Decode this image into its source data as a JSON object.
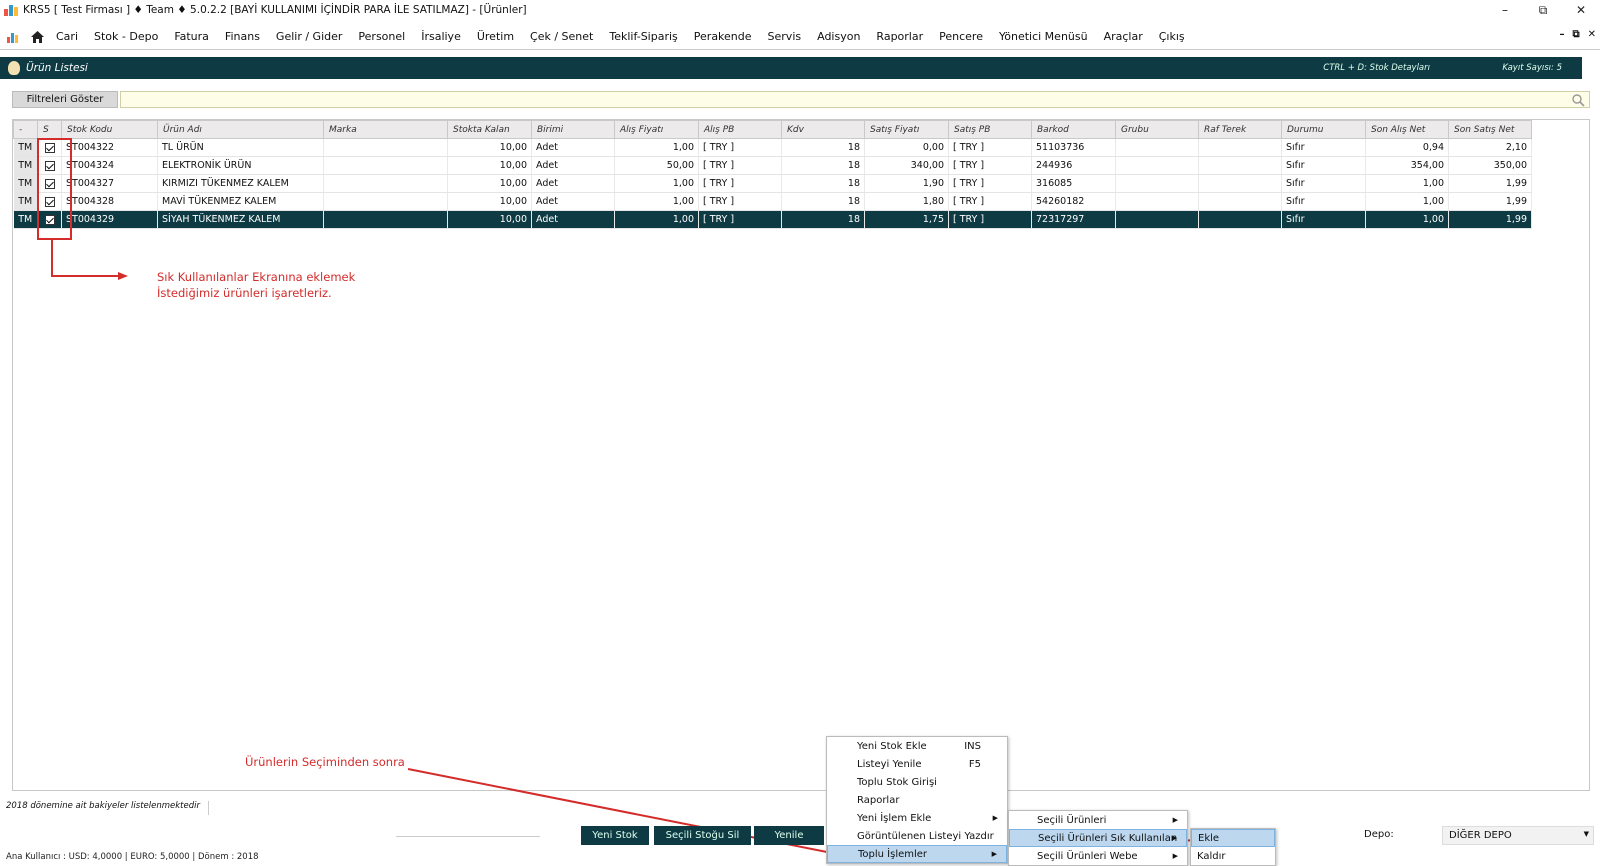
{
  "window": {
    "title": "KRS5 [ Test Firması ] ♦ Team ♦ 5.0.2.2 [BAYİ KULLANIMI İÇİNDİR PARA İLE SATILMAZ] - [Ürünler]"
  },
  "menu": [
    "Cari",
    "Stok - Depo",
    "Fatura",
    "Finans",
    "Gelir / Gider",
    "Personel",
    "İrsaliye",
    "Üretim",
    "Çek / Senet",
    "Teklif-Sipariş",
    "Perakende",
    "Servis",
    "Adisyon",
    "Raporlar",
    "Pencere",
    "Yönetici Menüsü",
    "Araçlar",
    "Çıkış"
  ],
  "panel": {
    "title": "Ürün Listesi",
    "hint": "CTRL + D: Stok Detayları",
    "count": "Kayıt Sayısı: 5"
  },
  "filter": {
    "button": "Filtreleri Göster",
    "value": ""
  },
  "grid": {
    "columns": [
      "-",
      "S",
      "Stok Kodu",
      "Ürün Adı",
      "Marka",
      "Stokta Kalan",
      "Birimi",
      "Alış Fiyatı",
      "Alış PB",
      "Kdv",
      "Satış Fiyatı",
      "Satış PB",
      "Barkod",
      "Grubu",
      "Raf Terek",
      "Durumu",
      "Son Alış Net",
      "Son Satış Net"
    ],
    "rows": [
      {
        "tm": "TM",
        "checked": true,
        "code": "ST004322",
        "name": "TL ÜRÜN",
        "marka": "",
        "stok": "10,00",
        "birim": "Adet",
        "alis": "1,00",
        "alis_pb": "[ TRY ]",
        "kdv": "18",
        "satis": "0,00",
        "satis_pb": "[ TRY ]",
        "barkod": "51103736",
        "grup": "",
        "raf": "",
        "durum": "Sıfır",
        "son_alis": "0,94",
        "son_satis": "2,10"
      },
      {
        "tm": "TM",
        "checked": true,
        "code": "ST004324",
        "name": "ELEKTRONİK ÜRÜN",
        "marka": "",
        "stok": "10,00",
        "birim": "Adet",
        "alis": "50,00",
        "alis_pb": "[ TRY ]",
        "kdv": "18",
        "satis": "340,00",
        "satis_pb": "[ TRY ]",
        "barkod": "244936",
        "grup": "",
        "raf": "",
        "durum": "Sıfır",
        "son_alis": "354,00",
        "son_satis": "350,00"
      },
      {
        "tm": "TM",
        "checked": true,
        "code": "ST004327",
        "name": "KIRMIZI TÜKENMEZ KALEM",
        "marka": "",
        "stok": "10,00",
        "birim": "Adet",
        "alis": "1,00",
        "alis_pb": "[ TRY ]",
        "kdv": "18",
        "satis": "1,90",
        "satis_pb": "[ TRY ]",
        "barkod": "316085",
        "grup": "",
        "raf": "",
        "durum": "Sıfır",
        "son_alis": "1,00",
        "son_satis": "1,99"
      },
      {
        "tm": "TM",
        "checked": true,
        "code": "ST004328",
        "name": "MAVİ TÜKENMEZ KALEM",
        "marka": "",
        "stok": "10,00",
        "birim": "Adet",
        "alis": "1,00",
        "alis_pb": "[ TRY ]",
        "kdv": "18",
        "satis": "1,80",
        "satis_pb": "[ TRY ]",
        "barkod": "54260182",
        "grup": "",
        "raf": "",
        "durum": "Sıfır",
        "son_alis": "1,00",
        "son_satis": "1,99"
      },
      {
        "tm": "TM",
        "checked": true,
        "code": "ST004329",
        "name": "SİYAH TÜKENMEZ KALEM",
        "marka": "",
        "stok": "10,00",
        "birim": "Adet",
        "alis": "1,00",
        "alis_pb": "[ TRY ]",
        "kdv": "18",
        "satis": "1,75",
        "satis_pb": "[ TRY ]",
        "barkod": "72317297",
        "grup": "",
        "raf": "",
        "durum": "Sıfır",
        "son_alis": "1,00",
        "son_satis": "1,99",
        "selected": true
      }
    ]
  },
  "annotations": {
    "mark_line1": "Sık Kullanılanlar Ekranına eklemek",
    "mark_line2": "İstediğimiz ürünleri işaretleriz.",
    "after_selection": "Ürünlerin Seçiminden sonra"
  },
  "status": {
    "balance_note": "2018 dönemine ait bakiyeler listelenmektedir",
    "bar": "Ana Kullanıcı :  USD: 4,0000 | EURO: 5,0000   | Dönem : 2018"
  },
  "buttons": {
    "new_stock": "Yeni Stok",
    "delete_selected": "Seçili Stoğu Sil",
    "refresh": "Yenile"
  },
  "depo": {
    "label": "Depo:",
    "value": "DİĞER DEPO"
  },
  "context_menu": [
    {
      "label": "Yeni Stok Ekle",
      "shortcut": "INS"
    },
    {
      "label": "Listeyi Yenile",
      "shortcut": "F5"
    },
    {
      "label": "Toplu Stok Girişi"
    },
    {
      "label": "Raporlar"
    },
    {
      "label": "Yeni İşlem Ekle",
      "submenu": true
    },
    {
      "label": "Görüntülenen Listeyi Yazdır"
    },
    {
      "label": "Toplu İşlemler",
      "submenu": true,
      "highlighted": true
    }
  ],
  "submenu1": [
    {
      "label": "Seçili Ürünleri"
    },
    {
      "label": "Seçili Ürünleri Sık Kullanılan",
      "highlighted": true
    },
    {
      "label": "Seçili Ürünleri Webe"
    }
  ],
  "submenu2": [
    {
      "label": "Ekle",
      "highlighted": true
    },
    {
      "label": "Kaldır"
    }
  ],
  "colors": {
    "header": "#0e3a43",
    "annotation": "#d42b2b",
    "highlight": "#bcd7ee"
  }
}
